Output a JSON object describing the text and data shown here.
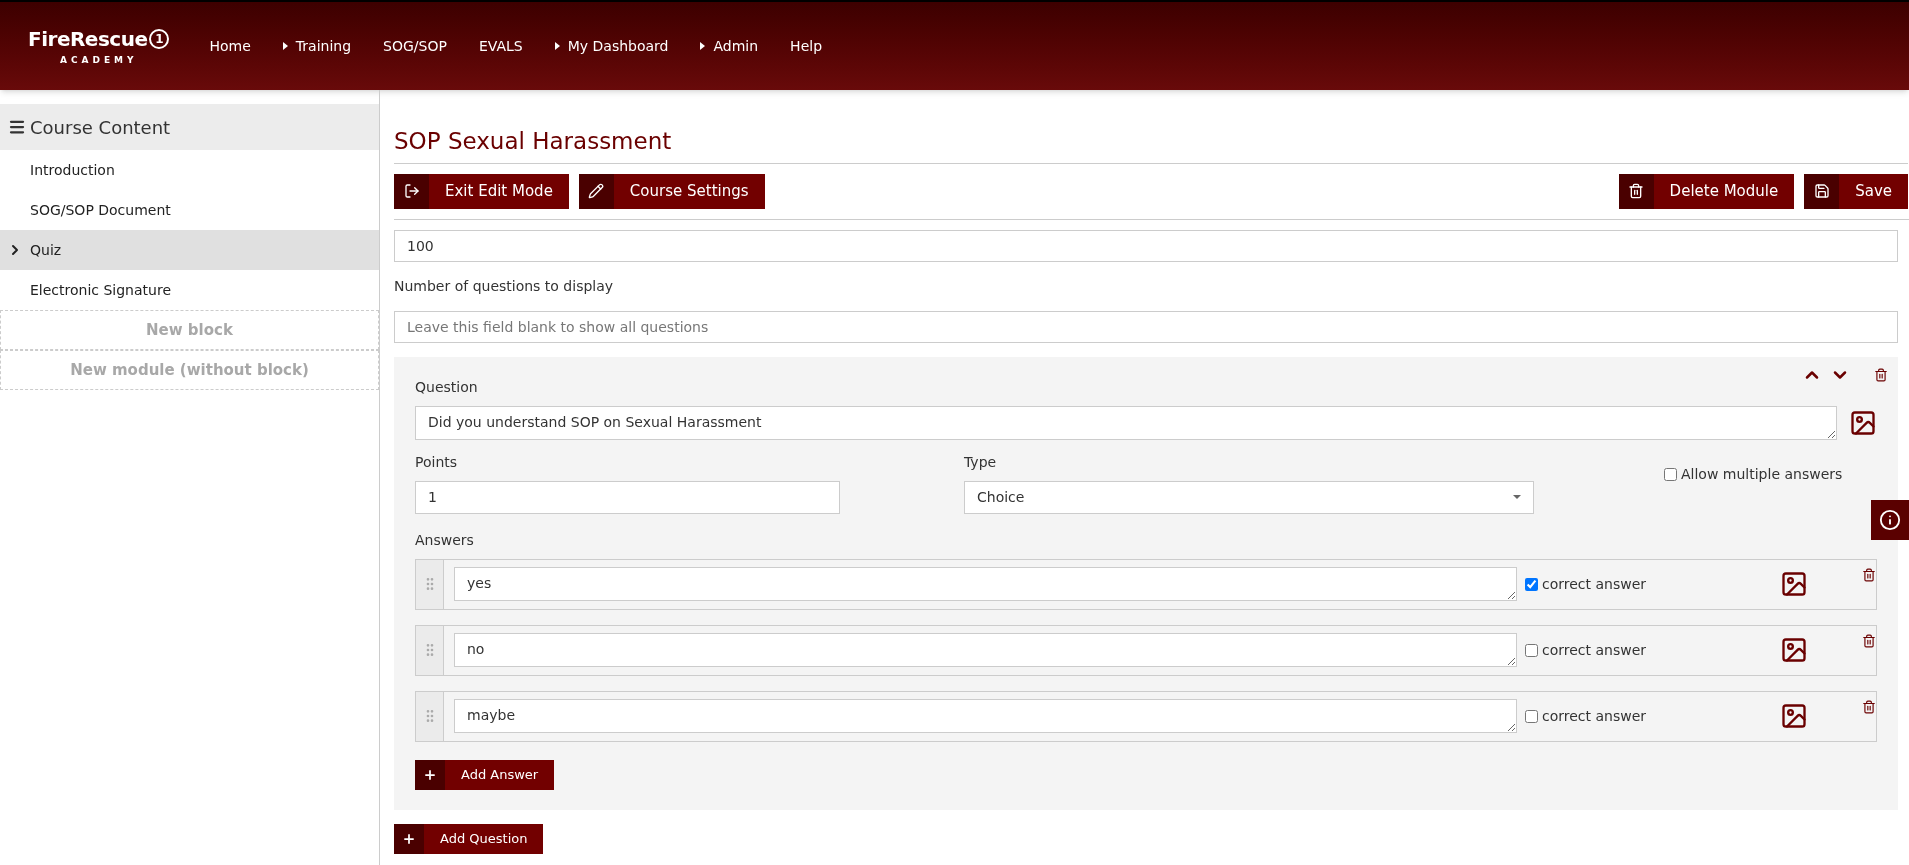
{
  "logo": {
    "name": "FireRescue",
    "suffix": "1",
    "tagline": "ACADEMY"
  },
  "nav": [
    {
      "label": "Home",
      "has_submenu": false
    },
    {
      "label": "Training",
      "has_submenu": true
    },
    {
      "label": "SOG/SOP",
      "has_submenu": false
    },
    {
      "label": "EVALS",
      "has_submenu": false
    },
    {
      "label": "My Dashboard",
      "has_submenu": true
    },
    {
      "label": "Admin",
      "has_submenu": true
    },
    {
      "label": "Help",
      "has_submenu": false
    }
  ],
  "sidebar": {
    "title": "Course Content",
    "items": [
      {
        "label": "Introduction",
        "selected": false
      },
      {
        "label": "SOG/SOP Document",
        "selected": false
      },
      {
        "label": "Quiz",
        "selected": true
      },
      {
        "label": "Electronic Signature",
        "selected": false
      }
    ],
    "add_buttons": [
      "New block",
      "New module (without block)"
    ]
  },
  "page_title": "SOP Sexual Harassment",
  "toolbar_left": [
    {
      "label": "Exit Edit Mode"
    },
    {
      "label": "Course Settings"
    }
  ],
  "toolbar_right": [
    {
      "label": "Delete Module"
    },
    {
      "label": "Save"
    }
  ],
  "passing_score_value": "100",
  "question_count": {
    "label": "Number of questions to display",
    "placeholder": "Leave this field blank to show all questions"
  },
  "question": {
    "label": "Question",
    "value": "Did you understand SOP on Sexual Harassment",
    "points_label": "Points",
    "points_value": "1",
    "type_label": "Type",
    "type_value": "Choice",
    "allow_multiple": {
      "label": "Allow multiple answers",
      "checked": false
    },
    "answers_label": "Answers",
    "answers": [
      {
        "value": "yes",
        "correct_label": "correct answer",
        "checked": true
      },
      {
        "value": "no",
        "correct_label": "correct answer",
        "checked": false
      },
      {
        "value": "maybe",
        "correct_label": "correct answer",
        "checked": false
      }
    ],
    "add_answer": "Add Answer"
  },
  "add_question": "Add Question"
}
